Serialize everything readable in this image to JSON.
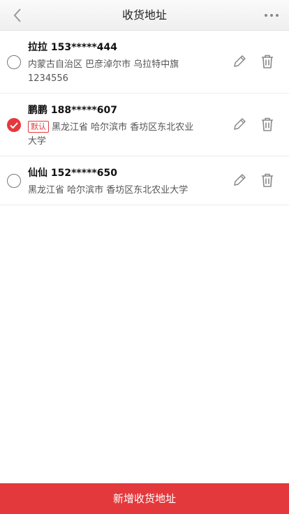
{
  "header": {
    "title": "收货地址",
    "back_icon": "chevron-left-icon",
    "more_icon": "more-dots-icon"
  },
  "addresses": [
    {
      "name": "拉拉",
      "phone": "153*****444",
      "is_default": false,
      "default_tag": "",
      "address": "内蒙古自治区 巴彦淖尔市 乌拉特中旗 1234556"
    },
    {
      "name": "鹏鹏",
      "phone": "188*****607",
      "is_default": true,
      "default_tag": "默认",
      "address": "黑龙江省 哈尔滨市 香坊区东北农业大学"
    },
    {
      "name": "仙仙",
      "phone": "152*****650",
      "is_default": false,
      "default_tag": "",
      "address": "黑龙江省 哈尔滨市 香坊区东北农业大学"
    }
  ],
  "footer": {
    "add_label": "新增收货地址"
  },
  "colors": {
    "accent": "#e4393c",
    "header_bg": "#f3f3f3"
  }
}
